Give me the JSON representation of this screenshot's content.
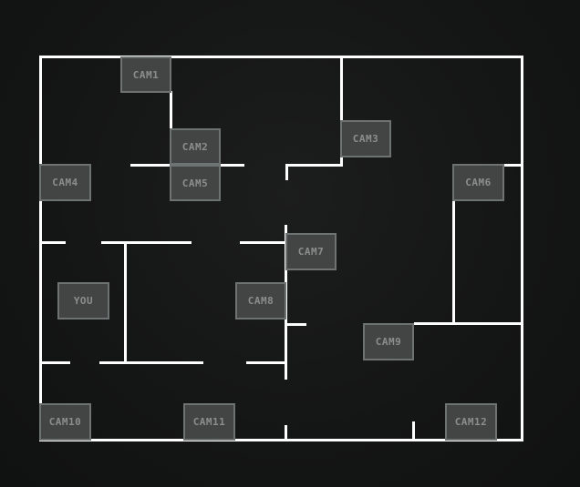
{
  "map": {
    "cameras": [
      {
        "id": "cam1",
        "label": "CAM1"
      },
      {
        "id": "cam2",
        "label": "CAM2"
      },
      {
        "id": "cam3",
        "label": "CAM3"
      },
      {
        "id": "cam4",
        "label": "CAM4"
      },
      {
        "id": "cam5",
        "label": "CAM5"
      },
      {
        "id": "cam6",
        "label": "CAM6"
      },
      {
        "id": "cam7",
        "label": "CAM7"
      },
      {
        "id": "cam8",
        "label": "CAM8"
      },
      {
        "id": "cam9",
        "label": "CAM9"
      },
      {
        "id": "cam10",
        "label": "CAM10"
      },
      {
        "id": "cam11",
        "label": "CAM11"
      },
      {
        "id": "cam12",
        "label": "CAM12"
      }
    ],
    "player": {
      "label": "YOU"
    }
  },
  "colors": {
    "background": "#141515",
    "wall": "#ffffff",
    "cam_fill": "#434545",
    "cam_border": "#6d7372",
    "cam_text": "#8a8e8d"
  }
}
